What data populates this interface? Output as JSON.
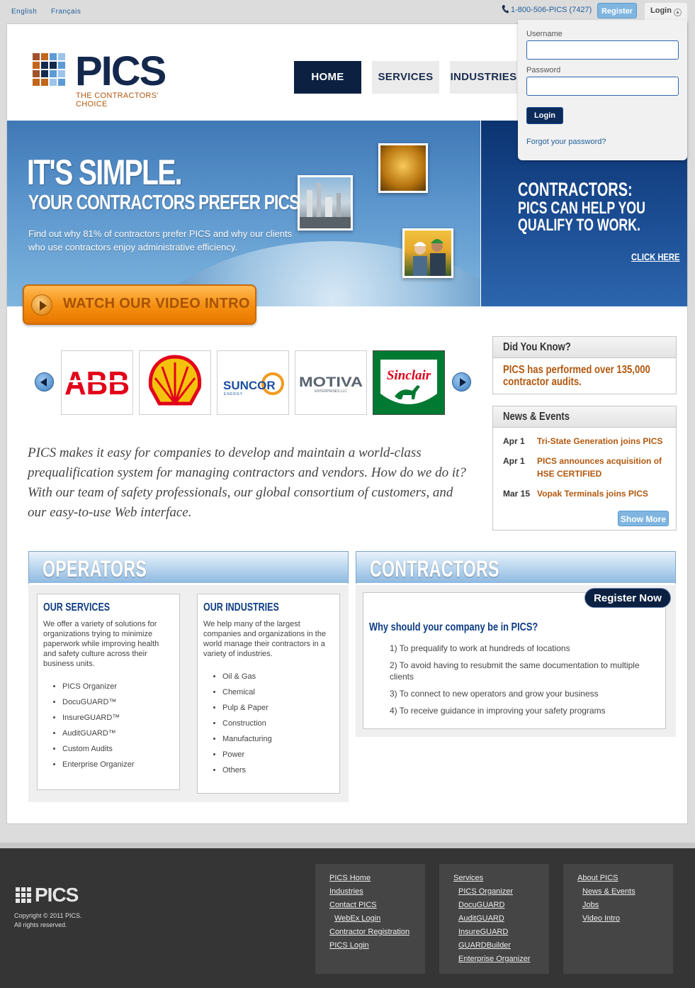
{
  "topbar": {
    "lang_en": "English",
    "lang_fr": "Français",
    "phone": "1-800-506-PICS (7427)",
    "register": "Register",
    "login": "Login"
  },
  "brand": {
    "name": "PICS",
    "tagline": "THE CONTRACTORS' CHOICE"
  },
  "nav": [
    {
      "label": "HOME",
      "active": true
    },
    {
      "label": "SERVICES",
      "active": false
    },
    {
      "label": "INDUSTRIES",
      "active": false
    }
  ],
  "login_panel": {
    "username_label": "Username",
    "password_label": "Password",
    "button": "Login",
    "forgot": "Forgot your password?"
  },
  "hero": {
    "headline": "IT'S SIMPLE.",
    "subhead": "YOUR CONTRACTORS PREFER PICS.",
    "body": "Find out why 81% of contractors prefer PICS and why our clients who use contractors enjoy administrative efficiency.",
    "video_button": "WATCH OUR VIDEO INTRO"
  },
  "promo": {
    "title": "CONTRACTORS:",
    "line1": "PICS CAN HELP YOU",
    "line2": "QUALIFY TO WORK.",
    "cta": "CLICK HERE"
  },
  "client_logos": [
    {
      "name": "ABB",
      "text": "ABB",
      "color": "#e2001a"
    },
    {
      "name": "Shell",
      "text": "",
      "color": "#f4c20d"
    },
    {
      "name": "Suncor",
      "text": "SUNCOR",
      "sub": "ENERGY",
      "color": "#1b4fa0"
    },
    {
      "name": "Motiva",
      "text": "MOTIVA",
      "sub": "ENTERPRISES LLC",
      "color": "#5a6470"
    },
    {
      "name": "Sinclair",
      "text": "Sinclair",
      "color": "#007a33"
    }
  ],
  "intro": "PICS makes it easy for companies to develop and maintain a world-class prequalification system for managing contractors and vendors. How do we do it? With our team of safety professionals, our global consortium of customers, and our easy-to-use Web interface.",
  "did_you_know": {
    "title": "Did You Know?",
    "line1": "PICS has performed over 135,000",
    "line2": "contractor audits."
  },
  "news": {
    "title": "News & Events",
    "items": [
      {
        "date": "Apr 1",
        "text": "Tri-State Generation joins PICS"
      },
      {
        "date": "Apr 1",
        "text": "PICS announces acquisition of HSE CERTIFIED"
      },
      {
        "date": "Mar 15",
        "text": "Vopak Terminals joins PICS"
      }
    ],
    "show_more": "Show More"
  },
  "operators": {
    "title": "OPERATORS",
    "services": {
      "title": "OUR SERVICES",
      "text": "We offer a variety of solutions for organizations trying to minimize paperwork while improving health and safety culture across their business units.",
      "items": [
        "PICS Organizer",
        "DocuGUARD™",
        "InsureGUARD™",
        "AuditGUARD™",
        "Custom Audits",
        "Enterprise Organizer"
      ]
    },
    "industries": {
      "title": "OUR INDUSTRIES",
      "text": "We help many of the largest companies and organizations in the world manage their contractors in a variety of industries.",
      "items": [
        "Oil & Gas",
        "Chemical",
        "Pulp & Paper",
        "Construction",
        "Manufacturing",
        "Power",
        "Others"
      ]
    }
  },
  "contractors": {
    "title": "CONTRACTORS",
    "register_now": "Register Now",
    "question": "Why should your company be in PICS?",
    "reasons": [
      "1) To prequalify to work at hundreds of locations",
      "2) To avoid having to resubmit the same documentation to multiple clients",
      "3) To connect to new operators and grow your business",
      "4) To receive guidance in improving your safety programs"
    ]
  },
  "footer": {
    "brand": "PICS",
    "copyright": "Copyright © 2011 PICS.",
    "rights": "All rights reserved.",
    "col1": [
      "PICS Home",
      "Industries",
      "Contact PICS",
      "WebEx Login",
      "Contractor Registration",
      "PICS Login"
    ],
    "col2": [
      "Services",
      "PICS Organizer",
      "DocuGUARD",
      "AuditGUARD",
      "InsureGUARD",
      "GUARDBuilder",
      "Enterprise Organizer"
    ],
    "col3": [
      "About PICS",
      "News & Events",
      "Jobs",
      "Video Intro"
    ]
  }
}
